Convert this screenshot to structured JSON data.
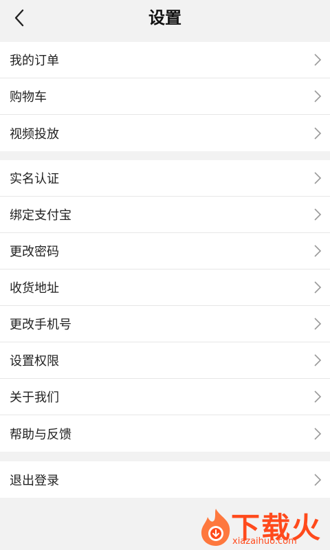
{
  "header": {
    "title": "设置"
  },
  "groups": [
    {
      "items": [
        {
          "label": "我的订单"
        },
        {
          "label": "购物车"
        },
        {
          "label": "视频投放"
        }
      ]
    },
    {
      "items": [
        {
          "label": "实名认证"
        },
        {
          "label": "绑定支付宝"
        },
        {
          "label": "更改密码"
        },
        {
          "label": "收货地址"
        },
        {
          "label": "更改手机号"
        },
        {
          "label": "设置权限"
        },
        {
          "label": "关于我们"
        },
        {
          "label": "帮助与反馈"
        }
      ]
    },
    {
      "items": [
        {
          "label": "退出登录"
        }
      ]
    }
  ],
  "watermark": {
    "brand": "下载火",
    "url": "xiazaihuo.com"
  },
  "colors": {
    "background": "#f2f2f2",
    "row": "#ffffff",
    "divider": "#e6e6e6",
    "chevron": "#999999",
    "watermark": "#ff4a1c"
  }
}
